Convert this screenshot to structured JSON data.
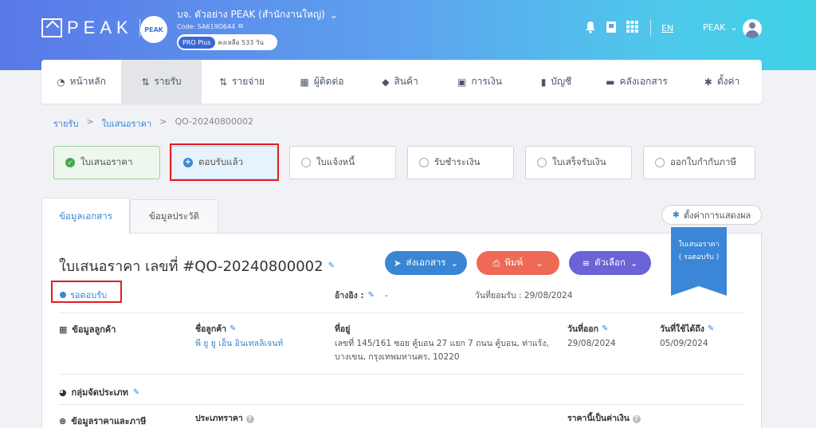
{
  "header": {
    "logo_text": "PEAK",
    "company_logo_text": "PEAK",
    "company_name": "บจ. ตัวอย่าง PEAK (สำนักงานใหญ่)",
    "company_code": "Code: SA619D644",
    "plan_badge": "PRO Plus",
    "plan_days": "คงเหลือ 533 วัน",
    "lang": "EN",
    "user": "PEAK",
    "icons": [
      "bell-icon",
      "book-icon",
      "apps-grid-icon"
    ]
  },
  "nav": [
    {
      "label": "หน้าหลัก",
      "icon": "chart-icon"
    },
    {
      "label": "รายรับ",
      "icon": "sort-icon",
      "active": true
    },
    {
      "label": "รายจ่าย",
      "icon": "sort-icon"
    },
    {
      "label": "ผู้ติดต่อ",
      "icon": "contacts-icon"
    },
    {
      "label": "สินค้า",
      "icon": "box-icon"
    },
    {
      "label": "การเงิน",
      "icon": "money-icon"
    },
    {
      "label": "บัญชี",
      "icon": "ledger-icon"
    },
    {
      "label": "คลังเอกสาร",
      "icon": "folder-icon"
    },
    {
      "label": "ตั้งค่า",
      "icon": "gear-icon"
    }
  ],
  "breadcrumb": [
    "รายรับ",
    "ใบเสนอราคา",
    "QO-20240800002"
  ],
  "steps": [
    {
      "label": "ใบเสนอราคา",
      "state": "done"
    },
    {
      "label": "ตอบรับแล้ว",
      "state": "current"
    },
    {
      "label": "ใบแจ้งหนี้",
      "state": "todo"
    },
    {
      "label": "รับชำระเงิน",
      "state": "todo"
    },
    {
      "label": "ใบเสร็จรับเงิน",
      "state": "todo"
    },
    {
      "label": "ออกใบกำกับภาษี",
      "state": "todo"
    }
  ],
  "tabs": [
    "ข้อมูลเอกสาร",
    "ข้อมูลประวัติ"
  ],
  "display_settings": "ตั้งค่าการแสดงผล",
  "document": {
    "title": "ใบเสนอราคา เลขที่ #QO-20240800002",
    "status": "รอตอบรับ",
    "ribbon_line1": "ใบเสนอราคา",
    "ribbon_line2": "( รอตอบรับ )",
    "reference_label": "อ้างอิง :",
    "reference_value": "-",
    "accept_date": "วันที่ยอมรับ : 29/08/2024"
  },
  "buttons": {
    "send": "ส่งเอกสาร",
    "print": "พิมพ์",
    "options": "ตัวเลือก"
  },
  "colors": {
    "send": "#3a86d4",
    "print": "#ee6a55",
    "options": "#6b63d6"
  },
  "customer": {
    "section": "ข้อมูลลูกค้า",
    "name_label": "ชื่อลูกค้า",
    "name": "พี ยู ยู เอ็น อินเทลลิเจนท์",
    "address_label": "ที่อยู่",
    "address_line1": "เลขที่ 145/161 ซอย คู้บอน 27 แยก 7 ถนน คู้บอน, ท่าแร้ง,",
    "address_line2": "บางเขน, กรุงเทพมหานคร, 10220",
    "issue_label": "วันที่ออก",
    "issue_date": "29/08/2024",
    "valid_label": "วันที่ใช้ได้ถึง",
    "valid_date": "05/09/2024"
  },
  "category": {
    "section": "กลุ่มจัดประเภท"
  },
  "pricing": {
    "section": "ข้อมูลราคาและภาษี",
    "price_type_label": "ประเภทราคา",
    "currency_label": "ราคานี้เป็นค่าเงิน"
  }
}
